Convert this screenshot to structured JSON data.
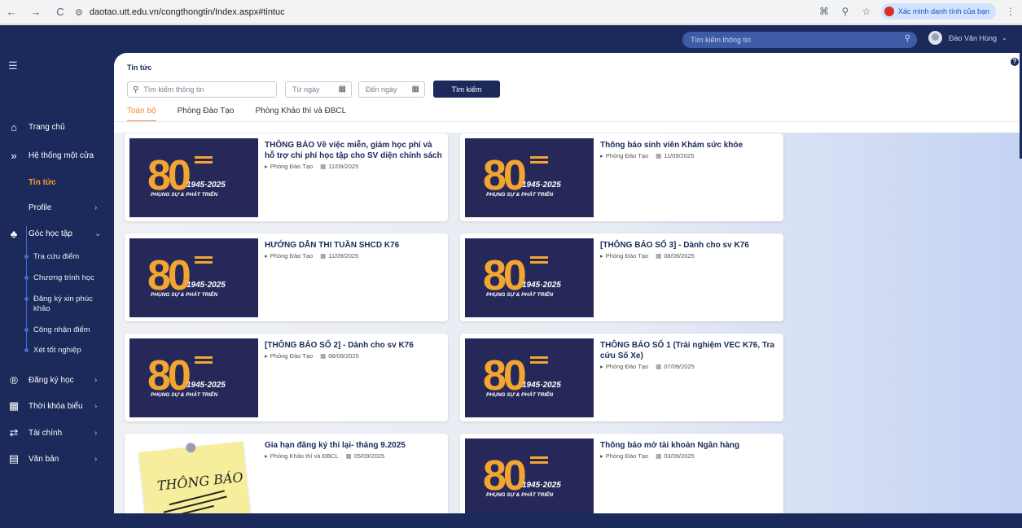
{
  "browser": {
    "url": "daotao.utt.edu.vn/congthongtin/Index.aspx#tintuc",
    "verify_label": "Xác minh danh tính của bạn"
  },
  "topbar": {
    "search_placeholder": "Tìm kiếm thông tin",
    "user_name": "Đào Văn Hùng"
  },
  "sidebar": {
    "items": [
      {
        "label": "Trang chủ",
        "icon": "home-icon"
      },
      {
        "label": "Hệ thống một cửa",
        "icon": "double-chevron-icon"
      },
      {
        "label": "Tin tức",
        "icon": ""
      },
      {
        "label": "Profile",
        "icon": ""
      },
      {
        "label": "Góc học tập",
        "icon": "group-icon"
      },
      {
        "label": "Đăng ký học",
        "icon": "registration-icon"
      },
      {
        "label": "Thời khóa biểu",
        "icon": "calendar-icon"
      },
      {
        "label": "Tài chính",
        "icon": "transfer-icon"
      },
      {
        "label": "Văn bản",
        "icon": "document-icon"
      }
    ],
    "subitems": [
      "Tra cứu điểm",
      "Chương trình học",
      "Đăng ký xin phúc khảo",
      "Công nhận điểm",
      "Xét tốt nghiệp"
    ]
  },
  "main": {
    "title": "Tin tức",
    "search_placeholder": "Tìm kiếm thông tin",
    "from_date_placeholder": "Từ ngày",
    "to_date_placeholder": "Đến ngày",
    "search_button": "Tìm kiếm",
    "tabs": [
      "Toàn bộ",
      "Phòng Đào Tạo",
      "Phòng Khảo thí và ĐBCL"
    ]
  },
  "thumb": {
    "big": "80",
    "years": "1945·2025",
    "slogan": "PHỤNG SỰ & PHÁT TRIỂN",
    "note_text": "THÔNG BÁO"
  },
  "news": [
    {
      "title": "THÔNG BÁO Về việc miễn, giảm học phí và hỗ trợ chi phí học tập cho SV diện chính sách",
      "dept": "Phòng Đào Tạo",
      "date": "11/09/2025",
      "thumb": "anniversary"
    },
    {
      "title": "Thông báo sinh viên Khám sức khỏe",
      "dept": "Phòng Đào Tạo",
      "date": "11/09/2025",
      "thumb": "anniversary"
    },
    {
      "title": "HƯỚNG DẪN THI TUẦN SHCD K76",
      "dept": "Phòng Đào Tạo",
      "date": "11/09/2025",
      "thumb": "anniversary"
    },
    {
      "title": "[THÔNG BÁO SỐ 3] - Dành cho sv K76",
      "dept": "Phòng Đào Tạo",
      "date": "08/09/2025",
      "thumb": "anniversary"
    },
    {
      "title": "[THÔNG BÁO SỐ 2] - Dành cho sv K76",
      "dept": "Phòng Đào Tạo",
      "date": "08/09/2025",
      "thumb": "anniversary"
    },
    {
      "title": "THÔNG BÁO SỐ 1 (Trải nghiệm VEC K76, Tra cứu Số Xe)",
      "dept": "Phòng Đào Tạo",
      "date": "07/09/2025",
      "thumb": "anniversary"
    },
    {
      "title": "Gia hạn đăng ký thi lại- tháng 9.2025",
      "dept": "Phòng Khảo thí và ĐBCL",
      "date": "05/09/2025",
      "thumb": "note"
    },
    {
      "title": "Thông báo mở tài khoản Ngân hàng",
      "dept": "Phòng Đào Tạo",
      "date": "03/09/2025",
      "thumb": "anniversary"
    }
  ],
  "colors": {
    "brand_dark": "#1b2a5a",
    "accent_orange": "#f0863a",
    "sub_bullet": "#3d6fd0"
  }
}
